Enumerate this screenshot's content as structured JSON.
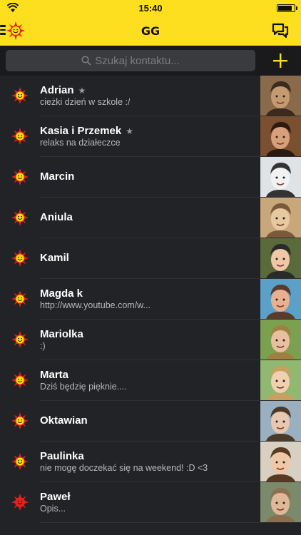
{
  "status_bar": {
    "time": "15:40",
    "wifi_icon": "wifi-icon",
    "battery_icon": "battery-icon"
  },
  "nav": {
    "title": "GG",
    "menu_icon": "menu-icon",
    "logo_icon": "gg-sun-icon",
    "chat_icon": "new-chat-icon"
  },
  "search": {
    "placeholder": "Szukaj kontaktu...",
    "icon": "search-icon",
    "add_icon": "plus-icon"
  },
  "colors": {
    "brand_yellow": "#fedf1f",
    "background": "#222326",
    "text": "#ffffff",
    "subtext": "#b8b9bd",
    "status_available": "#ffe000",
    "status_ring": "#e8201a",
    "status_busy": "#e8201a"
  },
  "contacts": [
    {
      "name": "Adrian",
      "favorite": true,
      "description": "cieżki dzień w szkole :/",
      "status": "available"
    },
    {
      "name": "Kasia i Przemek",
      "favorite": true,
      "description": "relaks na działeczce",
      "status": "available"
    },
    {
      "name": "Marcin",
      "favorite": false,
      "description": "",
      "status": "available"
    },
    {
      "name": "Aniula",
      "favorite": false,
      "description": "",
      "status": "available"
    },
    {
      "name": "Kamil",
      "favorite": false,
      "description": "",
      "status": "available"
    },
    {
      "name": "Magda k",
      "favorite": false,
      "description": "http://www.youtube.com/w...",
      "status": "available"
    },
    {
      "name": "Mariolka",
      "favorite": false,
      "description": ":)",
      "status": "available"
    },
    {
      "name": "Marta",
      "favorite": false,
      "description": "Dziś będzię pięknie....",
      "status": "available"
    },
    {
      "name": "Oktawian",
      "favorite": false,
      "description": "",
      "status": "available"
    },
    {
      "name": "Paulinka",
      "favorite": false,
      "description": "nie mogę doczekać się na weekend! :D <3",
      "status": "available"
    },
    {
      "name": "Paweł",
      "favorite": false,
      "description": "Opis...",
      "status": "busy"
    }
  ],
  "favorite_symbol": "★"
}
